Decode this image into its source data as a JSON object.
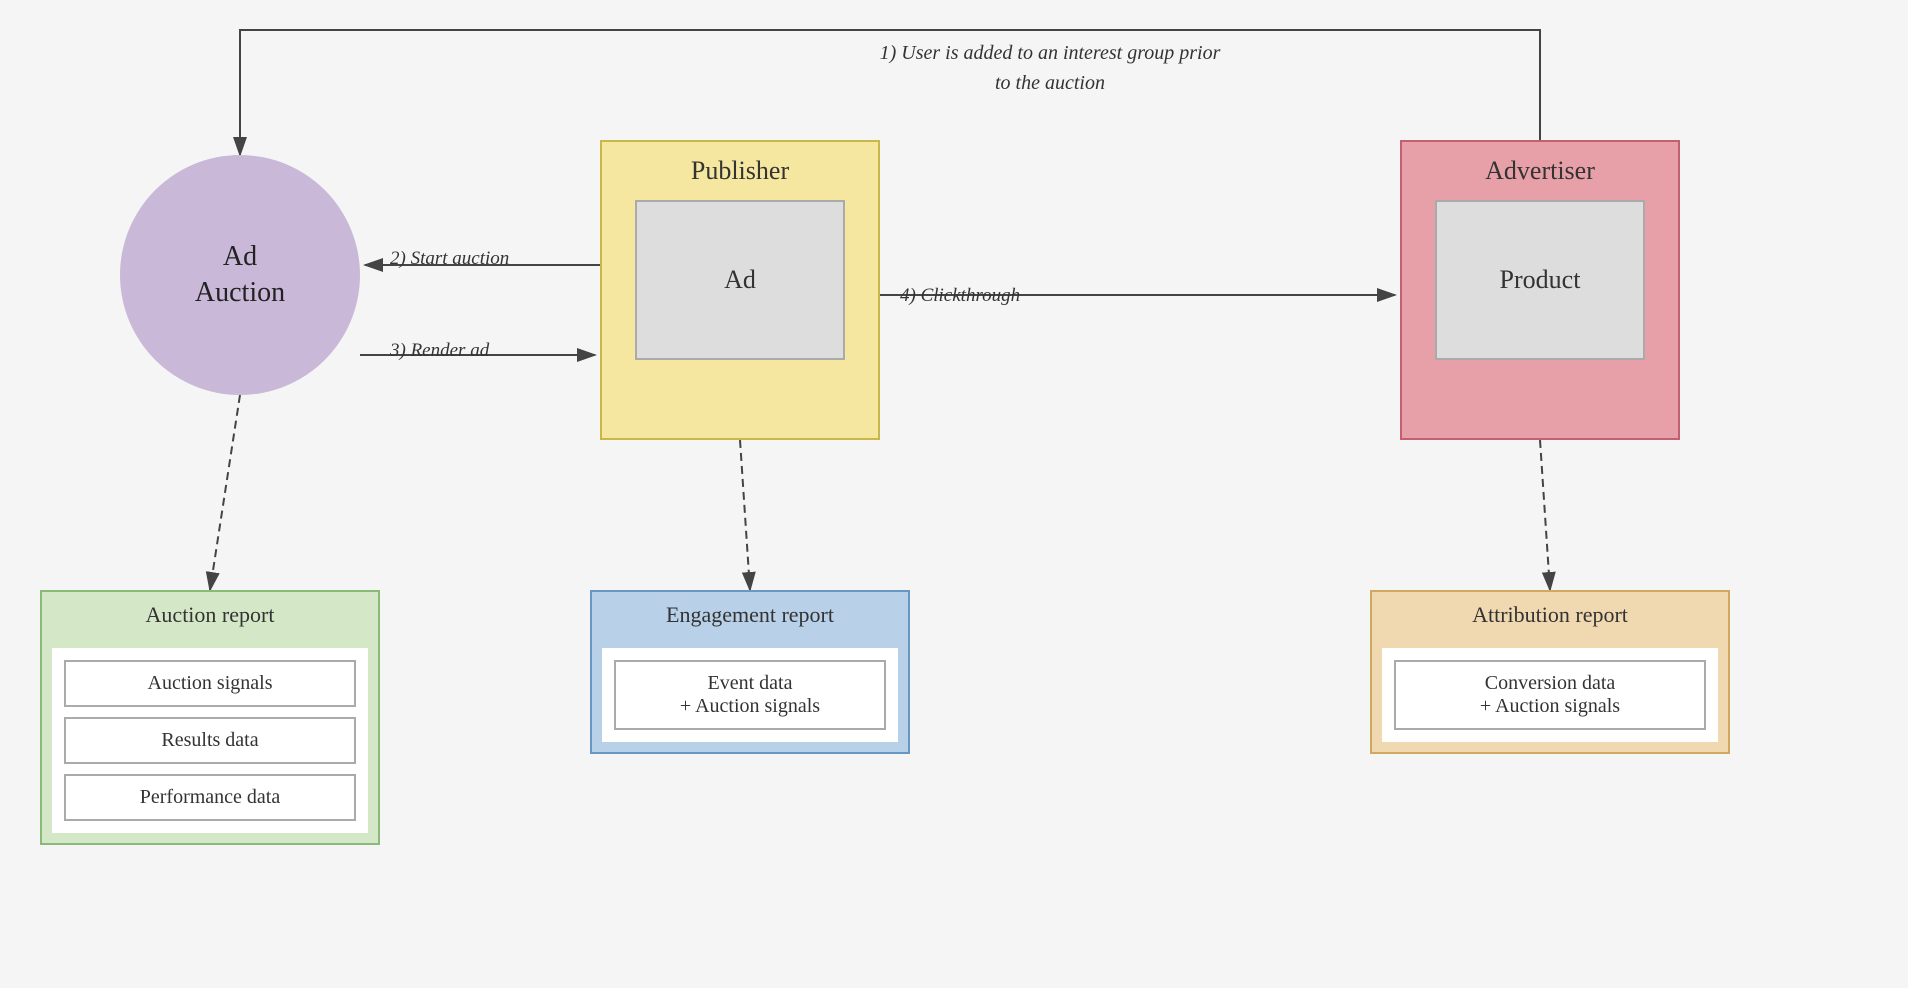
{
  "diagram": {
    "background_color": "#f5f5f5",
    "ad_auction": {
      "label_line1": "Ad",
      "label_line2": "Auction"
    },
    "publisher": {
      "title": "Publisher",
      "inner_label": "Ad"
    },
    "advertiser": {
      "title": "Advertiser",
      "inner_label": "Product"
    },
    "annotations": {
      "top_note": "1) User is added to an interest group prior to the auction",
      "start_auction": "2) Start auction",
      "render_ad": "3) Render ad",
      "clickthrough": "4) Clickthrough"
    },
    "auction_report": {
      "title": "Auction report",
      "items": [
        "Auction signals",
        "Results data",
        "Performance data"
      ]
    },
    "engagement_report": {
      "title": "Engagement report",
      "items": [
        "Event data\n+ Auction signals"
      ]
    },
    "attribution_report": {
      "title": "Attribution report",
      "items": [
        "Conversion data\n+ Auction signals"
      ]
    }
  }
}
